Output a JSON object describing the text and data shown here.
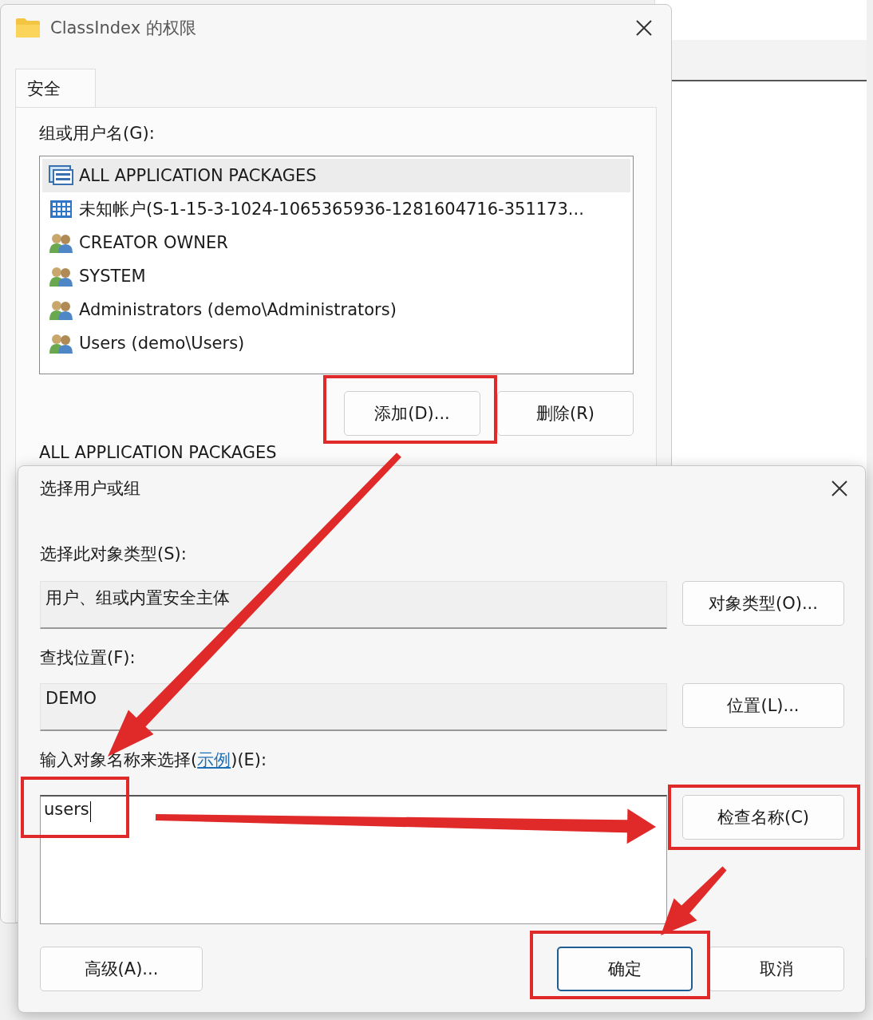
{
  "permissions_window": {
    "title": "ClassIndex 的权限",
    "tabs": [
      {
        "label": "安全",
        "selected": true
      }
    ],
    "group_label": "组或用户名(G):",
    "principals": [
      {
        "kind": "package",
        "name": "ALL APPLICATION PACKAGES",
        "selected": true
      },
      {
        "kind": "unknown",
        "name": "未知帐户(S-1-15-3-1024-1065365936-1281604716-351173...",
        "selected": false
      },
      {
        "kind": "group",
        "name": "CREATOR OWNER",
        "selected": false
      },
      {
        "kind": "group",
        "name": "SYSTEM",
        "selected": false
      },
      {
        "kind": "group",
        "name": "Administrators (demo\\Administrators)",
        "selected": false
      },
      {
        "kind": "group",
        "name": "Users (demo\\Users)",
        "selected": false
      }
    ],
    "buttons": [
      "添加(D)...",
      "删除(R)"
    ],
    "permissions_heading": "ALL APPLICATION PACKAGES"
  },
  "select_dialog": {
    "title": "选择用户或组",
    "object_type_label": "选择此对象类型(S):",
    "object_type_value": "用户、组或内置安全主体",
    "object_type_button": "对象类型(O)...",
    "location_label": "查找位置(F):",
    "location_value": "DEMO",
    "location_button": "位置(L)...",
    "names_label": {
      "before": "输入对象名称来选择(",
      "link": "示例",
      "after": ")(E):"
    },
    "names_value": "users",
    "check_button": "检查名称(C)",
    "advanced_button": "高级(A)...",
    "ok_button": "确定",
    "cancel_button": "取消"
  }
}
